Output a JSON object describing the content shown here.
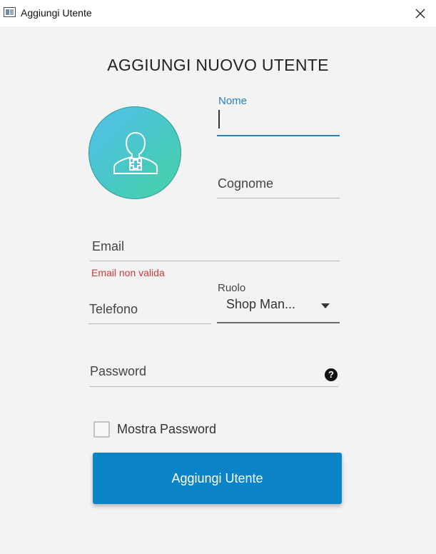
{
  "window": {
    "title": "Aggiungi Utente"
  },
  "form": {
    "heading": "AGGIUNGI NUOVO UTENTE",
    "nome_label": "Nome",
    "cognome_label": "Cognome",
    "email_label": "Email",
    "email_error": "Email non valida",
    "telefono_label": "Telefono",
    "ruolo_label": "Ruolo",
    "ruolo_value": "Shop Man...",
    "password_label": "Password",
    "help_icon": "?",
    "show_password_label": "Mostra Password",
    "submit_label": "Aggiungi Utente"
  },
  "icons": {
    "app": "app-window-icon",
    "close": "close-icon",
    "avatar": "medical-user-icon",
    "help": "question-circle-icon",
    "dropdown": "chevron-down-icon"
  },
  "colors": {
    "accent": "#2a80b9",
    "button": "#0a84c6",
    "error": "#d03a3a",
    "avatar_gradient_start": "#55bff0",
    "avatar_gradient_end": "#48d2a6"
  }
}
